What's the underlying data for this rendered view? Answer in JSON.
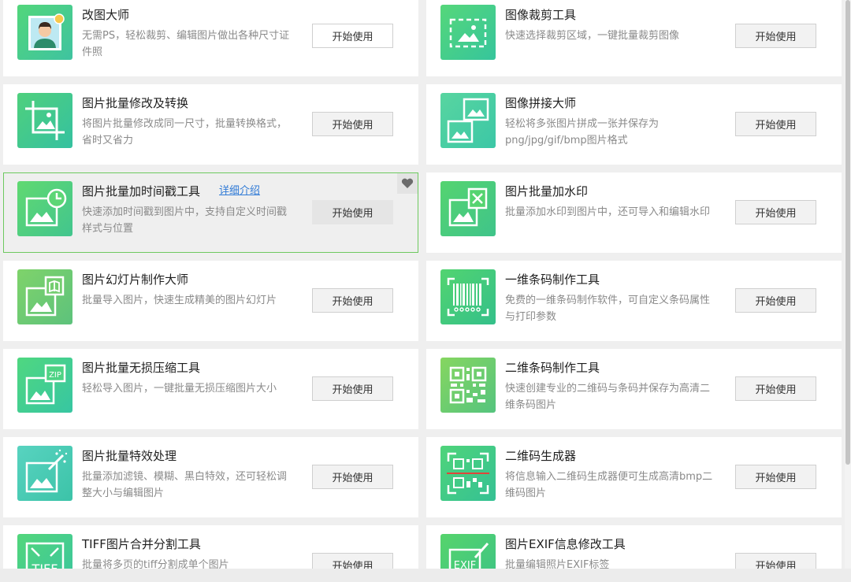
{
  "tools": [
    {
      "title": "改图大师",
      "desc": "无需PS，轻松裁剪、编辑图片做出各种尺寸证件照",
      "button": "开始使用",
      "icon": "portrait-id-photo-icon"
    },
    {
      "title": "图像裁剪工具",
      "desc": "快速选择裁剪区域，一键批量裁剪图像",
      "button": "开始使用",
      "icon": "crop-frame-icon"
    },
    {
      "title": "图片批量修改及转换",
      "desc": "将图片批量修改成同一尺寸，批量转换格式，省时又省力",
      "button": "开始使用",
      "icon": "crop-resize-icon"
    },
    {
      "title": "图像拼接大师",
      "desc": "轻松将多张图片拼成一张并保存为png/jpg/gif/bmp图片格式",
      "button": "开始使用",
      "icon": "image-stitch-icon"
    },
    {
      "title": "图片批量加时间戳工具",
      "link": "详细介绍",
      "desc": "快速添加时间戳到图片中，支持自定义时间戳样式与位置",
      "button": "开始使用",
      "icon": "image-clock-icon"
    },
    {
      "title": "图片批量加水印",
      "desc": "批量添加水印到图片中，还可导入和编辑水印",
      "button": "开始使用",
      "icon": "image-watermark-icon"
    },
    {
      "title": "图片幻灯片制作大师",
      "desc": "批量导入图片，快速生成精美的图片幻灯片",
      "button": "开始使用",
      "icon": "image-slideshow-icon"
    },
    {
      "title": "一维条码制作工具",
      "desc": "免费的一维条码制作软件，可自定义条码属性与打印参数",
      "button": "开始使用",
      "icon": "barcode-icon"
    },
    {
      "title": "图片批量无损压缩工具",
      "desc": "轻松导入图片，一键批量无损压缩图片大小",
      "button": "开始使用",
      "icon": "image-zip-icon"
    },
    {
      "title": "二维条码制作工具",
      "desc": "快速创建专业的二维码与条码并保存为高清二维条码图片",
      "button": "开始使用",
      "icon": "qr-code-icon"
    },
    {
      "title": "图片批量特效处理",
      "desc": "批量添加滤镜、模糊、黑白特效，还可轻松调整大小与编辑图片",
      "button": "开始使用",
      "icon": "image-magic-wand-icon"
    },
    {
      "title": "二维码生成器",
      "desc": "将信息输入二维码生成器便可生成高清bmp二维码图片",
      "button": "开始使用",
      "icon": "qr-scan-icon"
    },
    {
      "title": "TIFF图片合并分割工具",
      "desc": "批量将多页的tiff分割成单个图片",
      "button": "开始使用",
      "icon": "tiff-icon"
    },
    {
      "title": "图片EXIF信息修改工具",
      "desc": "批量编辑照片EXIF标签",
      "button": "开始使用",
      "icon": "exif-edit-icon"
    }
  ],
  "favorite_icon": "heart-icon",
  "colors": {
    "accent": "#6dc95f",
    "link": "#2f7ad6",
    "icon_green": "#4fd27a"
  }
}
